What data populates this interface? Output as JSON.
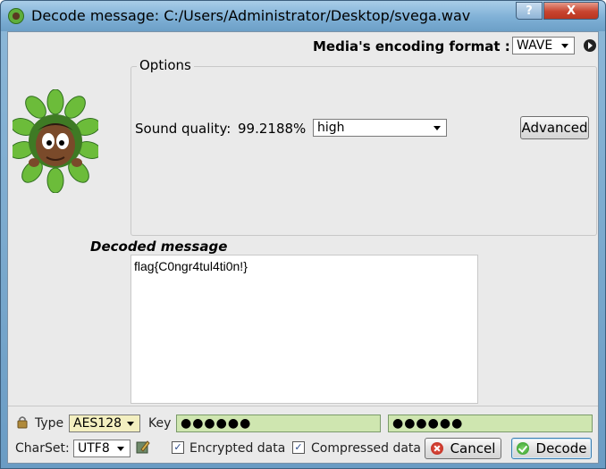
{
  "window": {
    "title": "Decode message: C:/Users/Administrator/Desktop/svega.wav",
    "help_label": "?",
    "close_label": "X"
  },
  "media": {
    "label": "Media's encoding format :",
    "format": "WAVE"
  },
  "options": {
    "legend": "Options",
    "sound_quality_label": "Sound quality:",
    "sound_quality_value": "99.2188%",
    "quality_select": "high",
    "advanced_label": "Advanced"
  },
  "decoded": {
    "label": "Decoded message",
    "text": "flag{C0ngr4tul4ti0n!}"
  },
  "footer": {
    "type_label": "Type",
    "type_value": "AES128",
    "key_label": "Key",
    "key_value": "●●●●●●",
    "key_confirm_value": "●●●●●●",
    "charset_label": "CharSet:",
    "charset_value": "UTF8",
    "encrypted_label": "Encrypted data",
    "encrypted_checked": "✓",
    "compressed_label": "Compressed data",
    "compressed_checked": "✓",
    "cancel_label": "Cancel",
    "decode_label": "Decode"
  },
  "icons": {
    "app": "app-icon",
    "play": "play-icon",
    "lock": "lock-icon",
    "pencil": "pencil-icon",
    "cancel": "cancel-icon",
    "decode": "ok-icon",
    "mascot": "mascot-image"
  }
}
